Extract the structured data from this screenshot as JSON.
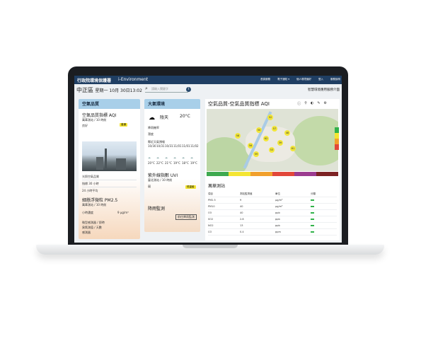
{
  "topbar": {
    "logo": "行政院環境保護署",
    "logo2": "i-Environment",
    "nav": [
      "首頁服務",
      "電子通知 ▾",
      "個人環境偏好",
      "登入",
      "服務說明"
    ]
  },
  "location": {
    "name": "中正區",
    "date": "星期一 10月 30日13:02"
  },
  "search": {
    "placeholder": "請輸入關鍵字"
  },
  "intro_link": "智慧環境應用服務介面",
  "air": {
    "header": "空氣品質",
    "aqi_title": "空氣品質指標 AQI",
    "aqi_sub": "萬華測站 / 10 時前",
    "aqi_badge": "普通",
    "aqi_status": "良好",
    "pm25_title": "細懸浮微粒 PM2.5",
    "pm25_sub": "萬華測站 / 10 時前",
    "pm25_label": "小時濃度",
    "pm25_value": "9 μg/m³",
    "rows": [
      "光照空氣品質",
      "指標 30 小時",
      "24 小時平均"
    ],
    "footer_rows": [
      "微型感測器 / 即時",
      "臭氧測值 / 天數",
      "感測器"
    ]
  },
  "env": {
    "header": "大氣環境",
    "weather": "陰天",
    "temp": "20°C",
    "rows": [
      "降雨機率",
      "濕度"
    ],
    "forecast_title": "鄰近天氣預報",
    "dates": [
      "10/30",
      "10/31",
      "10/31",
      "11/01",
      "11/01",
      "11/02"
    ],
    "temps": [
      "20°C",
      "22°C",
      "21°C",
      "19°C",
      "18°C",
      "19°C"
    ],
    "uv_title": "紫外線指數 UVI",
    "uv_sub": "臺北測站 / 10 時前",
    "uv_value": "弱",
    "uv_badge": "低量級",
    "rain_title": "降雨監測",
    "rain_button": "前往降雨監測"
  },
  "map": {
    "title": "空氣品質-空氣品質指標 AQI",
    "icons": [
      "info-icon",
      "marker-icon",
      "layers-icon",
      "pen-icon",
      "gear-icon"
    ],
    "stations": [
      "52",
      "50",
      "57",
      "62",
      "39",
      "56",
      "59",
      "48",
      "53",
      "61",
      "58"
    ],
    "legend_colors": [
      "#3ea94f",
      "#f4e532",
      "#f1a02c",
      "#e2473a",
      "#9b3c90",
      "#7d2324"
    ],
    "table_title": "萬華測站",
    "table_headers": [
      "項目",
      "測站監測值",
      "單位",
      "分類"
    ],
    "table_rows": [
      {
        "item": "PM2.5",
        "value": "9",
        "unit": "μg/m³"
      },
      {
        "item": "PM10",
        "value": "40",
        "unit": "μg/m³"
      },
      {
        "item": "O3",
        "value": "40",
        "unit": "ppb"
      },
      {
        "item": "SO2",
        "value": "2.8",
        "unit": "ppb"
      },
      {
        "item": "NO2",
        "value": "13",
        "unit": "ppb"
      },
      {
        "item": "CO",
        "value": "0.4",
        "unit": "ppm"
      }
    ]
  }
}
